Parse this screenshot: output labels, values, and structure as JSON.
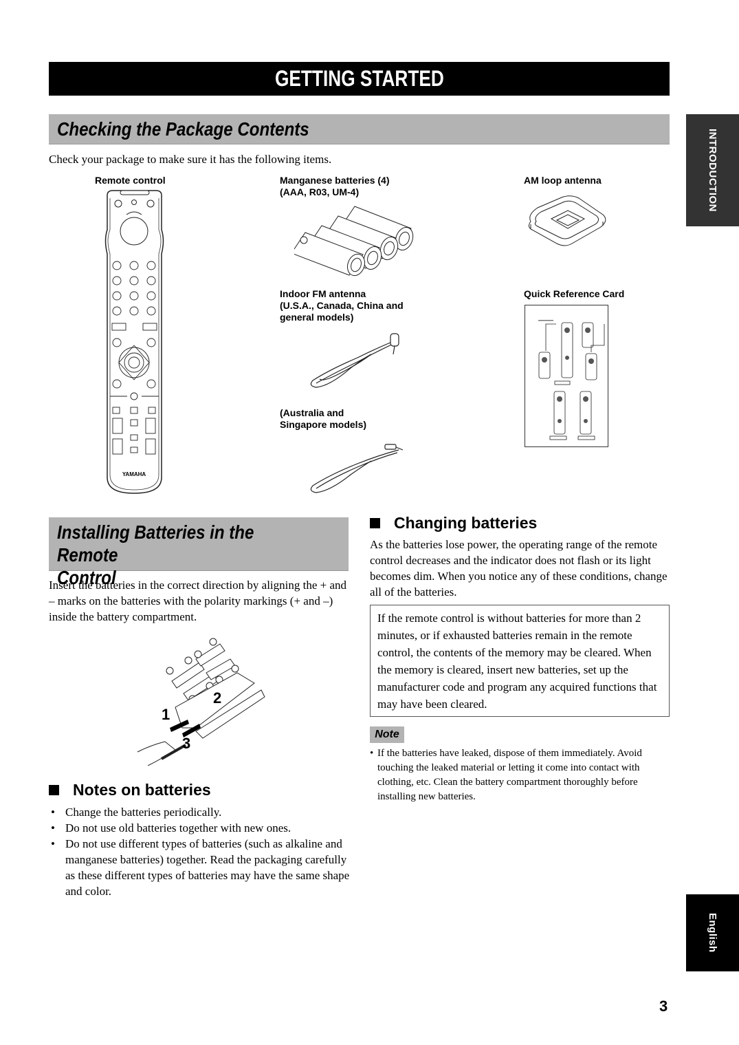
{
  "page": {
    "banner_title": "GETTING STARTED",
    "page_number": "3",
    "side_tabs": {
      "section": "INTRODUCTION",
      "language": "English"
    }
  },
  "package_contents": {
    "heading": "Checking the Package Contents",
    "intro": "Check your package to make sure it has the following items.",
    "items": [
      {
        "label": "Remote control",
        "icon": "remote-control-illustration"
      },
      {
        "label": "Manganese batteries (4)\n(AAA, R03, UM-4)",
        "icon": "batteries-illustration"
      },
      {
        "label": "AM loop antenna",
        "icon": "am-loop-antenna-illustration"
      },
      {
        "label": "Indoor FM antenna\n(U.S.A., Canada, China and\ngeneral models)",
        "icon": "fm-antenna-illustration"
      },
      {
        "label": "Quick Reference Card",
        "icon": "quick-reference-card-illustration"
      },
      {
        "label": "(Australia and\nSingapore models)",
        "icon": "fm-antenna-illustration"
      }
    ],
    "remote_brand": "YAMAHA"
  },
  "installing": {
    "heading": "Installing Batteries in the Remote\nControl",
    "instructions": "Insert the batteries in the correct direction by aligning the + and – marks on the batteries with the polarity markings (+ and –) inside the battery compartment.",
    "diagram_steps": [
      "1",
      "2",
      "3"
    ]
  },
  "notes_on_batteries": {
    "heading": "Notes on batteries",
    "bullets": [
      "Change the batteries periodically.",
      "Do not use old batteries together with new ones.",
      "Do not use different types of batteries (such as alkaline and manganese batteries) together. Read the packaging carefully as these different types of batteries may have the same shape and color."
    ]
  },
  "changing_batteries": {
    "heading": "Changing batteries",
    "text": "As the batteries lose power, the operating range of the remote control decreases and the indicator does not flash or its light becomes dim. When you notice any of these conditions, change all of the batteries.",
    "boxed_warning": "If the remote control is without batteries for more than 2 minutes, or if exhausted batteries remain in the remote control, the contents of the memory may be cleared. When the memory is cleared, insert new batteries, set up the manufacturer code and program any acquired functions that may have been cleared.",
    "note_label": "Note",
    "notes": [
      "If the batteries have leaked, dispose of them immediately. Avoid touching the leaked material or letting it come into contact with clothing, etc. Clean the battery compartment thoroughly before installing new batteries."
    ]
  }
}
